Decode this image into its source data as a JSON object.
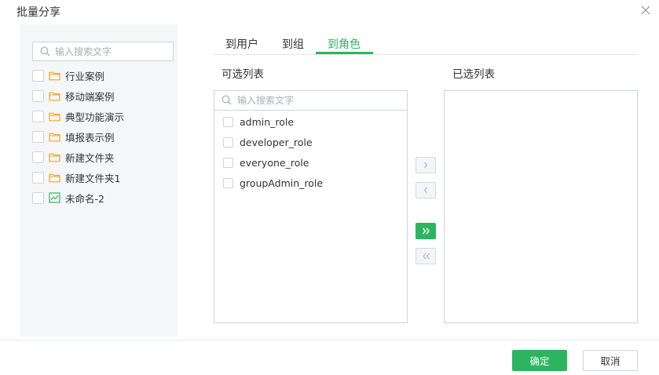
{
  "dialog": {
    "title": "批量分享",
    "close_icon": "close-icon"
  },
  "left_panel": {
    "search_placeholder": "输入搜索文字",
    "items": [
      {
        "label": "行业案例",
        "icon": "folder-icon"
      },
      {
        "label": "移动端案例",
        "icon": "folder-icon"
      },
      {
        "label": "典型功能演示",
        "icon": "folder-icon"
      },
      {
        "label": "填报表示例",
        "icon": "folder-icon"
      },
      {
        "label": "新建文件夹",
        "icon": "folder-icon"
      },
      {
        "label": "新建文件夹1",
        "icon": "folder-icon"
      },
      {
        "label": "未命名-2",
        "icon": "line-chart-icon"
      }
    ]
  },
  "tabs": [
    {
      "label": "到用户",
      "active": false
    },
    {
      "label": "到组",
      "active": false
    },
    {
      "label": "到角色",
      "active": true
    }
  ],
  "available": {
    "title": "可选列表",
    "search_placeholder": "输入搜索文字",
    "items": [
      "admin_role",
      "developer_role",
      "everyone_role",
      "groupAdmin_role"
    ]
  },
  "selected_list": {
    "title": "已选列表",
    "items": []
  },
  "transfer": {
    "move_right": "›",
    "move_left": "‹",
    "move_all_right": "»",
    "move_all_left": "«"
  },
  "footer": {
    "ok_label": "确定",
    "cancel_label": "取消"
  },
  "colors": {
    "accent": "#2db460",
    "folder": "#f5a623",
    "border": "#cfd3d9",
    "panel_bg": "#f5f6f8"
  }
}
